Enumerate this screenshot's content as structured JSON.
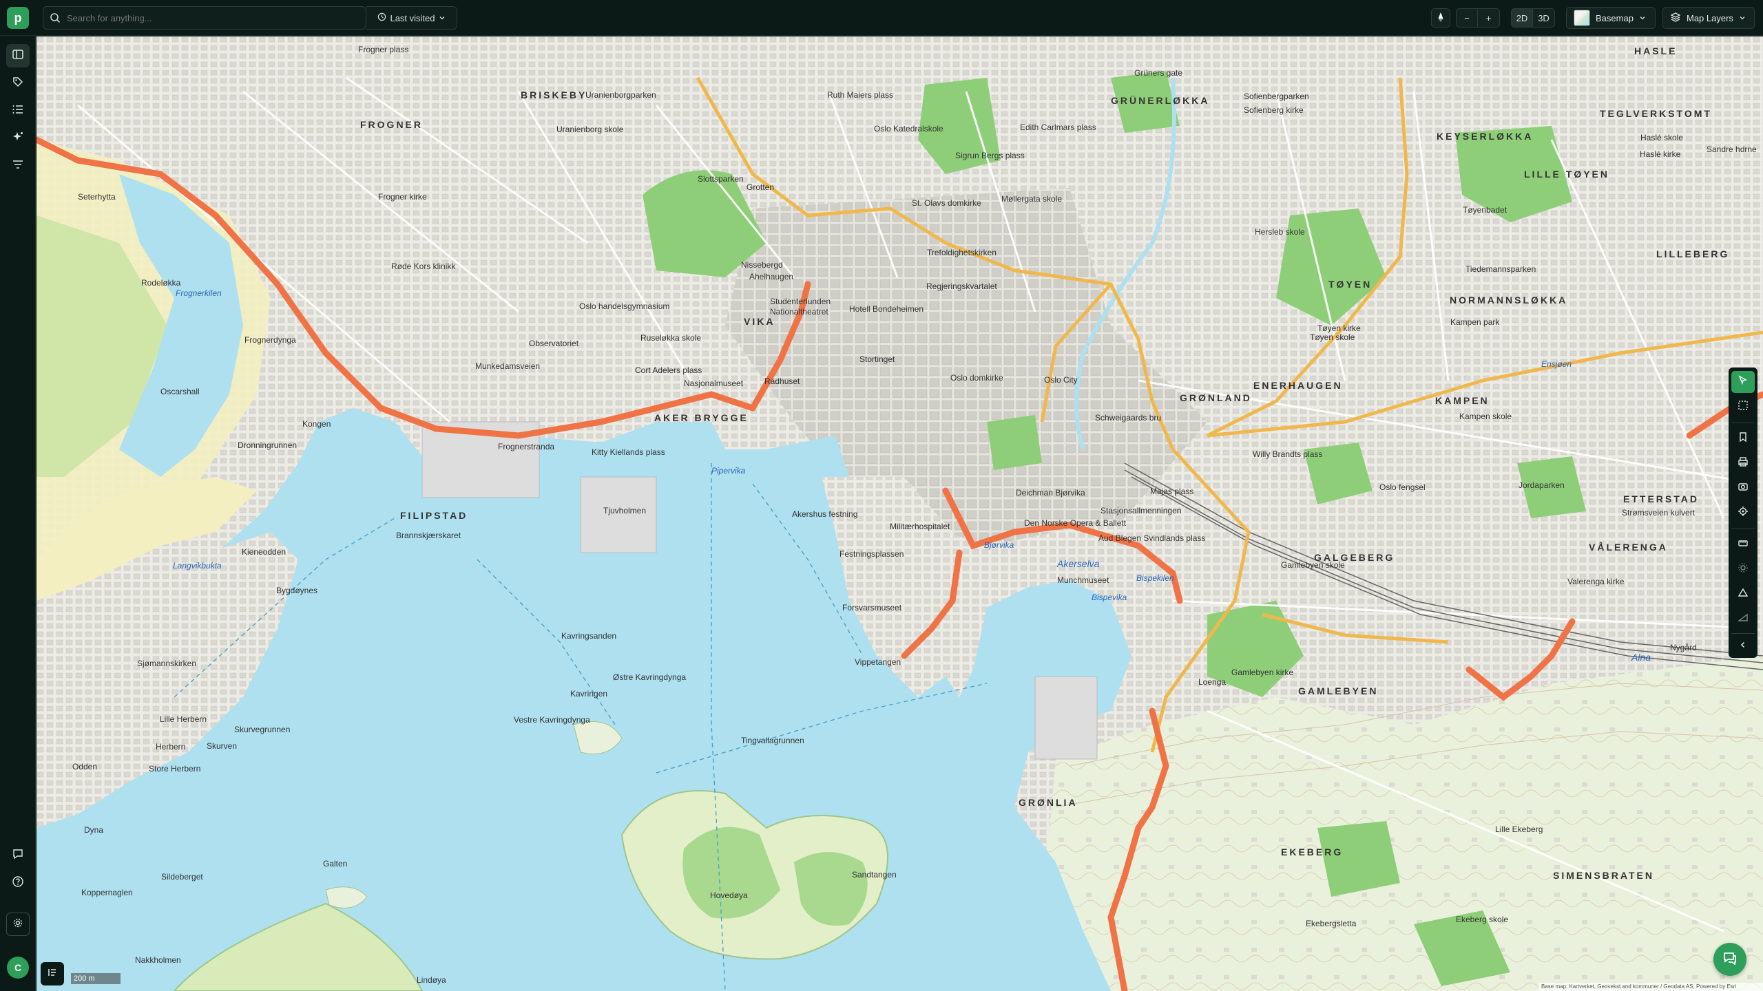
{
  "app": {
    "logo_letter": "p"
  },
  "search": {
    "placeholder": "Search for anything..."
  },
  "last_visited": {
    "label": "Last visited"
  },
  "view_controls": {
    "mode_2d": "2D",
    "mode_3d": "3D",
    "zoom_out": "−",
    "zoom_in": "+"
  },
  "basemap": {
    "label": "Basemap"
  },
  "map_layers": {
    "label": "Map Layers"
  },
  "user": {
    "initial": "C"
  },
  "scale": {
    "label": "200 m"
  },
  "attribution": "Base map: Kartverket, Geovekst and kommuner / Geodata AS, Powered by Esri",
  "map": {
    "districts": [
      "BRISKEBY",
      "FROGNER",
      "GRÜNERLØKKA",
      "HASLE",
      "TEGLVERKSTOMT",
      "KEYSERLØKKA",
      "LILLE TØYEN",
      "LILLEBERG",
      "TØYEN",
      "NORMANNSLØKKA",
      "VIKA",
      "AKER BRYGGE",
      "FILIPSTAD",
      "GRØNLAND",
      "ENERHAUGEN",
      "KAMPEN",
      "ETTERSTAD",
      "VÅLERENGA",
      "GALGEBERG",
      "GAMLEBYEN",
      "GRØNLIA",
      "EKEBERG",
      "SIMENSBRATEN"
    ],
    "places": [
      "Frogner plass",
      "Uranienborgparken",
      "Uranienborg skole",
      "Ruth Maiers plass",
      "Oslo Katedralskole",
      "Sigrun Bergs plass",
      "Edith Carlmars plass",
      "Grüners gate",
      "Sofienberg kirke",
      "Sofienbergparken",
      "Slottsparken",
      "Grotten",
      "St. Olavs domkirke",
      "Møllergata skole",
      "Frogner kirke",
      "Røde Kors klinikk",
      "Nissebergd",
      "Ahelhaugen",
      "Studenterlunden",
      "Nationaltheatret",
      "Hotell Bondeheimen",
      "Regjeringskvartalet",
      "Trefoldighetskirken",
      "Oslo handelsgymnasium",
      "Observatoriet",
      "Ruseløkka skole",
      "Cort Adelers plass",
      "Nasjonalmuseet",
      "Radhuset",
      "Stortinget",
      "Oslo domkirke",
      "Oslo City",
      "Schweigaards bru",
      "Tøyen kirke",
      "Tøyen skole",
      "Kampen park",
      "Kampen skole",
      "Munkedamsveien",
      "Seterhytta",
      "Rodeløkka",
      "Frognerkilen",
      "Frognerdynga",
      "Oscarshall",
      "Kongen",
      "Dronningrunnen",
      "Kitty Kiellands plass",
      "Akershus festning",
      "Militærhospitalet",
      "Festningsplassen",
      "Deichman Bjørvika",
      "Den Norske Opera & Ballett",
      "Stasjonsallmenningen",
      "Aud Blegen Svindlands plass",
      "Munchmuseet",
      "Forsvarsmuseet",
      "Vippetangen",
      "Tjuvholmen",
      "Brannskjærskaret",
      "Kieneodden",
      "Bygdøynes",
      "Kavringsanden",
      "Kavringen",
      "Østre Kavringdynga",
      "Vestre Kavringdynga",
      "Tingvallagrunnen",
      "Hovedøya",
      "Sandtangen",
      "Galten",
      "Sjømannskirken",
      "Lille Herbern",
      "Herbern",
      "Skurven",
      "Skurvegrunnen",
      "Store Herbern",
      "Odden",
      "Dyna",
      "Sildeberget",
      "Koppernaglen",
      "Nakkholmen",
      "Lindøya",
      "Gamlebyen skole",
      "Gamlebyen kirke",
      "Loenga",
      "Valerenga kirke",
      "Jordaparken",
      "Oslo fengsel",
      "Ekebergsletta",
      "Ekeberg skole",
      "Lille Ekeberg",
      "Nygård",
      "Tiedemannsparken",
      "Tøyenbadet",
      "Haslé kirke",
      "Haslé skole",
      "Sandre hdrne",
      "Strømsveien kulvert",
      "Frognerstranda",
      "Majas plass",
      "Willy Brandts plass",
      "Hersleb skole"
    ],
    "water_labels": [
      "Pipervika",
      "Bjørvika",
      "Akerselva",
      "Bispekilen",
      "Bispevika",
      "Langvikbukta",
      "Alna",
      "Ensjøen"
    ]
  },
  "colors": {
    "accent": "#2e9e5b",
    "chrome": "#0c1a17",
    "water": "#aee0ef",
    "road_major": "#f07346",
    "road_secondary": "#f0b84c",
    "park": "#8fce79"
  }
}
